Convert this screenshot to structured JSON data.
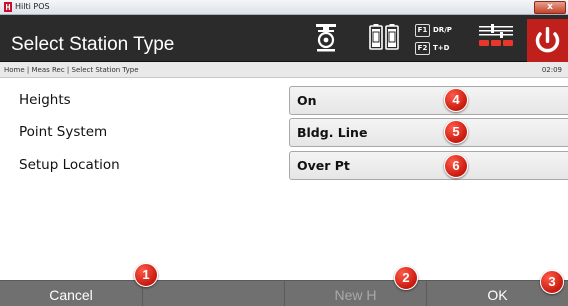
{
  "window": {
    "title": "Hilti POS",
    "close_glyph": "x",
    "app_icon": "hilti-logo-icon"
  },
  "header": {
    "page_title": "Select Station Type",
    "icons": [
      "prism-target-icon",
      "battery-icon",
      "face-indicator-icon",
      "settings-icon",
      "power-icon"
    ],
    "face_indicator": {
      "f1_key": "F1",
      "f1_text": "DR/P",
      "f2_key": "F2",
      "f2_text": "T+D"
    },
    "power_color": "#c0201c"
  },
  "breadcrumb": {
    "path": "Home | Meas Rec | Select Station Type",
    "time": "02:09"
  },
  "form": {
    "rows": [
      {
        "label": "Heights",
        "value": "On",
        "callout": "4"
      },
      {
        "label": "Point System",
        "value": "Bldg. Line",
        "callout": "5"
      },
      {
        "label": "Setup Location",
        "value": "Over Pt",
        "callout": "6"
      }
    ]
  },
  "bottom": {
    "cancel": {
      "label": "Cancel",
      "callout": "1"
    },
    "blank": {
      "label": ""
    },
    "new_h": {
      "label": "New H",
      "callout": "2",
      "enabled": false
    },
    "ok": {
      "label": "OK",
      "callout": "3"
    }
  },
  "colors": {
    "header_bg": "#2b2b2b",
    "callout": "#d8281a",
    "bottom_bar": "#707070",
    "disabled_text": "#a9a9a9"
  }
}
